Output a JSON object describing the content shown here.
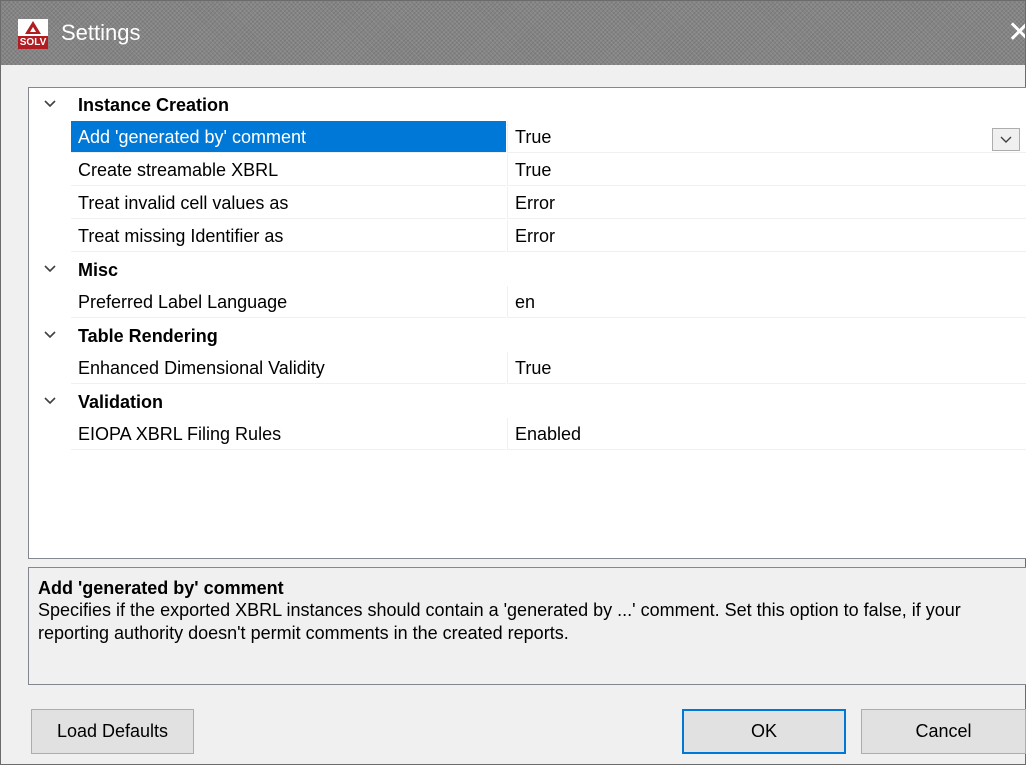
{
  "window": {
    "title": "Settings",
    "logo_text": "SOLV",
    "close_glyph": "✕"
  },
  "categories": [
    {
      "label": "Instance Creation",
      "properties": [
        {
          "name": "Add 'generated by' comment",
          "value": "True",
          "selected": true,
          "has_dropdown": true
        },
        {
          "name": "Create streamable XBRL",
          "value": "True"
        },
        {
          "name": "Treat invalid cell values as",
          "value": "Error"
        },
        {
          "name": "Treat missing Identifier as",
          "value": "Error"
        }
      ]
    },
    {
      "label": "Misc",
      "properties": [
        {
          "name": "Preferred Label Language",
          "value": "en"
        }
      ]
    },
    {
      "label": "Table Rendering",
      "properties": [
        {
          "name": "Enhanced Dimensional Validity",
          "value": "True"
        }
      ]
    },
    {
      "label": "Validation",
      "properties": [
        {
          "name": "EIOPA XBRL Filing Rules",
          "value": "Enabled"
        }
      ]
    }
  ],
  "help": {
    "title": "Add 'generated by' comment",
    "description": "Specifies if the exported XBRL instances should contain a 'generated by ...' comment. Set this option to false, if your reporting authority doesn't permit comments in the created reports."
  },
  "buttons": {
    "load_defaults": "Load Defaults",
    "ok": "OK",
    "cancel": "Cancel"
  },
  "colors": {
    "selection": "#0078d7",
    "titlebar": "#848484",
    "logo_red": "#b01e23"
  }
}
